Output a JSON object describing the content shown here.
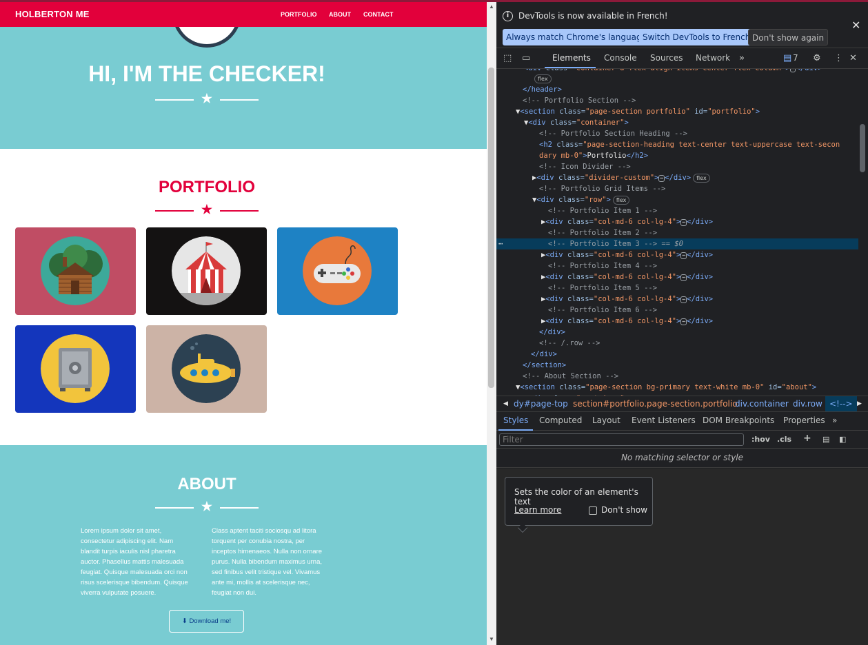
{
  "page": {
    "brand": "HOLBERTON ME",
    "nav": [
      "PORTFOLIO",
      "ABOUT",
      "CONTACT"
    ],
    "mast_title": "HI, I'M THE CHECKER!",
    "portfolio_heading": "PORTFOLIO",
    "portfolio_items": [
      {
        "name": "cabin",
        "bg": "#c04d64",
        "circle": "#3da99a"
      },
      {
        "name": "circus-tent",
        "bg": "#141212",
        "circle": "#e6e6e6"
      },
      {
        "name": "game-controller",
        "bg": "#1e82c4",
        "circle": "#e8793b"
      },
      {
        "name": "safe",
        "bg": "#1436bc",
        "circle": "#f2c43c"
      },
      {
        "name": "submarine",
        "bg": "#ccb3a6",
        "circle": "#2c4152"
      }
    ],
    "about_heading": "ABOUT",
    "about_left": "Lorem ipsum dolor sit amet, consectetur adipiscing elit. Nam blandit turpis iaculis nisl pharetra auctor. Phasellus mattis malesuada feugiat. Quisque malesuada orci non risus scelerisque bibendum. Quisque viverra vulputate posuere.",
    "about_right": "Class aptent taciti sociosqu ad litora torquent per conubia nostra, per inceptos himenaeos. Nulla non ornare purus. Nulla bibendum maximus urna, sed finibus velit tristique vel. Vivamus ante mi, mollis at scelerisque nec, feugiat non dui.",
    "download_label": "Download me!",
    "colors": {
      "brand": "#e2003b",
      "teal": "#79ccd2"
    }
  },
  "devtools": {
    "banner_text": "DevTools is now available in French!",
    "banner_btn_match": "Always match Chrome's language",
    "banner_btn_switch": "Switch DevTools to French",
    "banner_btn_dont": "Don't show again",
    "tabs": [
      "Elements",
      "Console",
      "Sources",
      "Network"
    ],
    "issues_count": "7",
    "crumbs": [
      "dy#page-top",
      "section#portfolio.page-section.portfolio",
      "div.container",
      "div.row",
      "<!-->"
    ],
    "subtabs": [
      "Styles",
      "Computed",
      "Layout",
      "Event Listeners",
      "DOM Breakpoints",
      "Properties"
    ],
    "filter_placeholder": "Filter",
    "hov": ":hov",
    "cls": ".cls",
    "no_match": "No matching selector or style",
    "tip_text": "Sets the color of an element's text",
    "tip_learn": "Learn more",
    "tip_dont_show": "Don't show"
  }
}
